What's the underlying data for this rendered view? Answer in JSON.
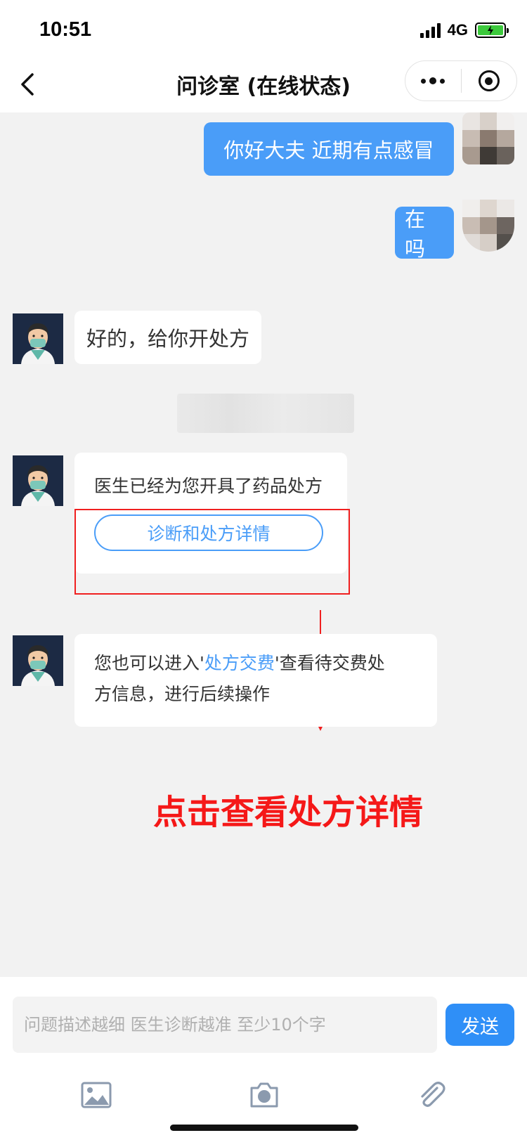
{
  "status_bar": {
    "time": "10:51",
    "network": "4G"
  },
  "nav": {
    "title": "问诊室 (在线状态)"
  },
  "messages": {
    "user_1": "你好大夫 近期有点感冒",
    "user_2": "在吗",
    "doctor_1": "好的，给你开处方",
    "doctor_2": "医生已经为您开具了药品处方",
    "detail_button": "诊断和处方详情",
    "doctor_3_before": "您也可以进入'",
    "doctor_3_link": "处方交费",
    "doctor_3_after_line1": "'查看待交费处",
    "doctor_3_line2": "方信息，进行后续操作"
  },
  "annotation": {
    "text": "点击查看处方详情",
    "color": "#f51818"
  },
  "input": {
    "placeholder": "问题描述越细 医生诊断越准 至少10个字",
    "send_label": "发送"
  },
  "toolbar_icons": [
    "image-icon",
    "camera-icon",
    "attachment-icon"
  ],
  "colors": {
    "accent": "#4a9df8",
    "send": "#2f8ff7",
    "chat_bg": "#f2f2f2",
    "annotation": "#f51818"
  }
}
